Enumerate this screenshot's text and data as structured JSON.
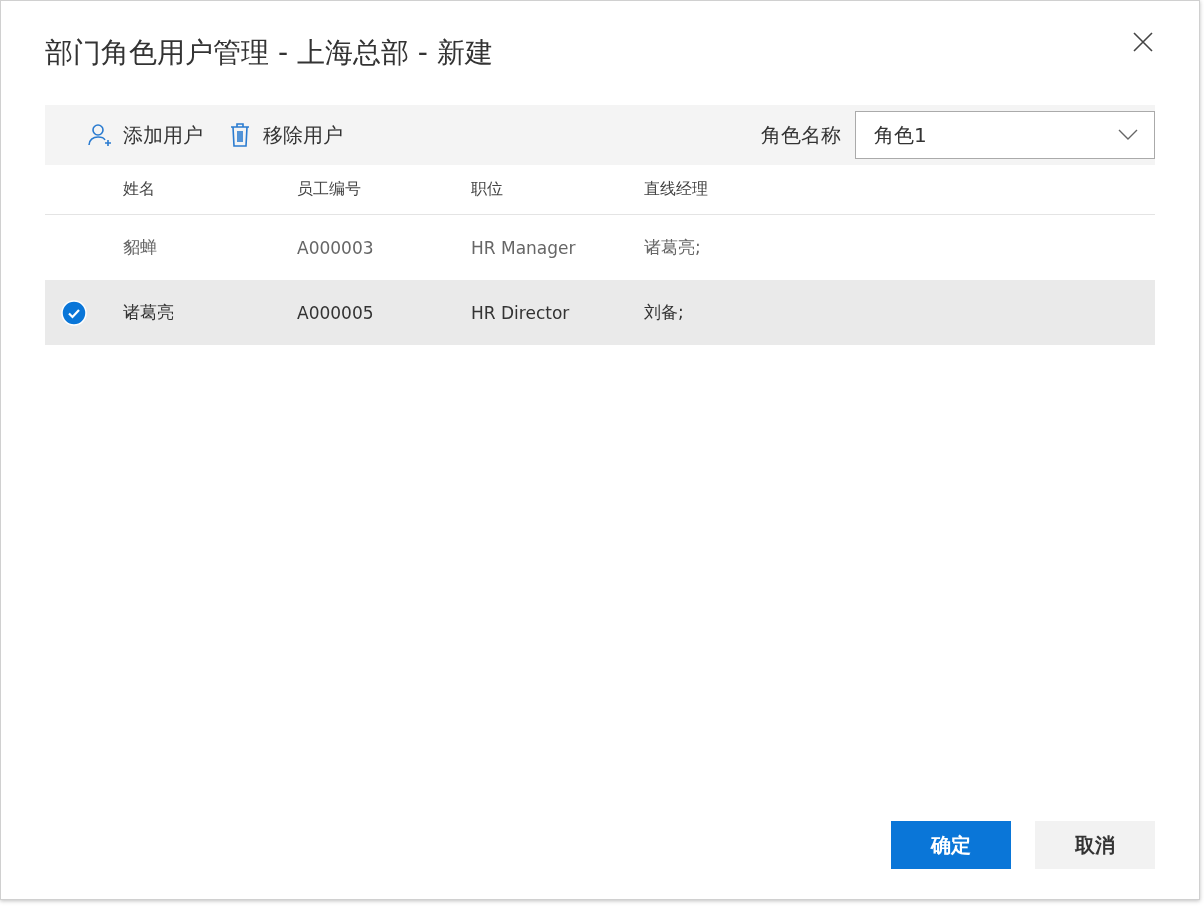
{
  "dialog": {
    "title": "部门角色用户管理 - 上海总部 - 新建"
  },
  "toolbar": {
    "actions": [
      {
        "kind": "add-user",
        "label": "添加用户"
      },
      {
        "kind": "remove-user",
        "label": "移除用户"
      }
    ],
    "role": {
      "label": "角色名称",
      "value": "角色1"
    }
  },
  "table": {
    "columns": [
      "姓名",
      "员工编号",
      "职位",
      "直线经理"
    ],
    "rows": [
      {
        "selected": false,
        "cells": [
          "貂蝉",
          "A000003",
          "HR Manager",
          "诸葛亮;"
        ]
      },
      {
        "selected": true,
        "cells": [
          "诸葛亮",
          "A000005",
          "HR Director",
          "刘备;"
        ]
      }
    ]
  },
  "buttons": [
    {
      "kind": "primary",
      "label": "确定"
    },
    {
      "kind": "secondary",
      "label": "取消"
    }
  ]
}
